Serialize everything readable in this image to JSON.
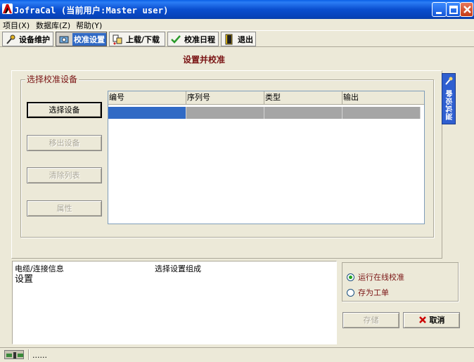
{
  "window": {
    "title": "JofraCal (当前用户:Master user)"
  },
  "menu": {
    "items": [
      {
        "label": "项目(X)"
      },
      {
        "label": "数据库(Z)"
      },
      {
        "label": "帮助(Y)"
      }
    ]
  },
  "toolbar": {
    "buttons": [
      {
        "label": "设备维护",
        "icon": "wrench-icon",
        "active": false
      },
      {
        "label": "校准设置",
        "icon": "calibration-setup-icon",
        "active": true
      },
      {
        "label": "上载/下载",
        "icon": "upload-download-icon",
        "active": false
      },
      {
        "label": "校准日程",
        "icon": "calendar-check-icon",
        "active": false
      },
      {
        "label": "退出",
        "icon": "exit-door-icon",
        "active": false
      }
    ]
  },
  "page": {
    "title": "设置并校准"
  },
  "device_group": {
    "legend": "选择校准设备",
    "buttons": {
      "select": "选择设备",
      "remove": "移出设备",
      "clear": "清除列表",
      "properties": "属性"
    },
    "table": {
      "columns": [
        "编号",
        "序列号",
        "类型",
        "输出"
      ],
      "selected_row": [
        "",
        "",
        "",
        ""
      ]
    }
  },
  "side_tab": {
    "label": "测试设备"
  },
  "info": {
    "cable_label": "电缆/连接信息",
    "setup_label": "选择设置组成",
    "setup_value": "设置"
  },
  "options": {
    "run_online": "运行在线校准",
    "save_workorder": "存为工单",
    "selected": "run_online"
  },
  "actions": {
    "save": "存储",
    "cancel": "取消"
  },
  "status": {
    "text": "......"
  },
  "colors": {
    "accent_text": "#7a1414",
    "selection": "#316ac5",
    "titlebar": "#0a4ecf"
  }
}
